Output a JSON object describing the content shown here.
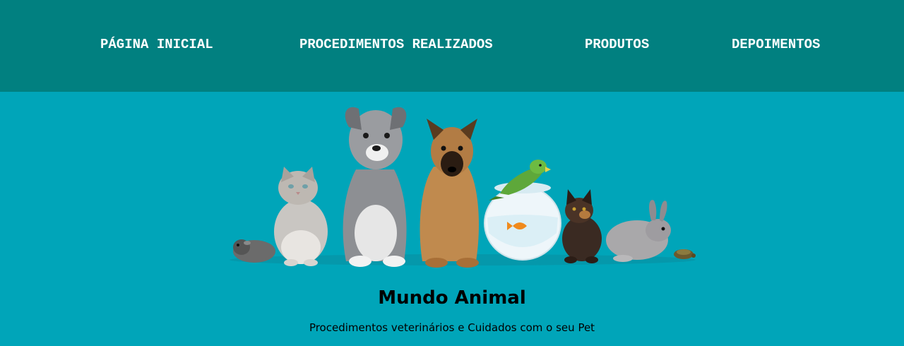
{
  "nav": {
    "items": [
      {
        "label": "PÁGINA INICIAL"
      },
      {
        "label": "PROCEDIMENTOS REALIZADOS"
      },
      {
        "label": "PRODUTOS"
      },
      {
        "label": "DEPOIMENTOS"
      }
    ]
  },
  "hero": {
    "image_subject": "group-of-pets",
    "title": "Mundo Animal",
    "subtitle": "Procedimentos veterinários e Cuidados com o seu Pet"
  },
  "colors": {
    "nav_background": "#018080",
    "page_background": "#00a5b9",
    "nav_text": "#ffffff"
  }
}
